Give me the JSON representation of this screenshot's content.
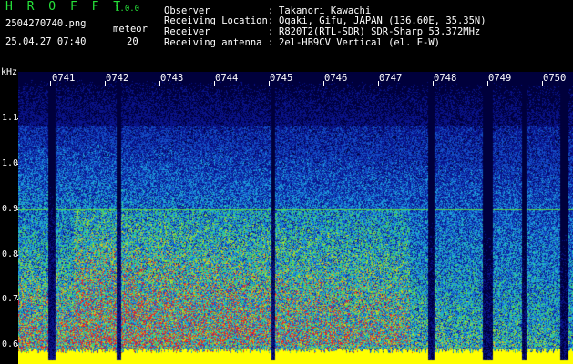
{
  "app": {
    "name": "H R O F F T",
    "version": "1.0.0"
  },
  "file": {
    "name": "2504270740.png",
    "datetime": "25.04.27 07:40"
  },
  "meteor": {
    "label": "meteor",
    "count": "20"
  },
  "info": [
    {
      "label": "Observer",
      "sep": ":",
      "value": "Takanori Kawachi"
    },
    {
      "label": "Receiving Location",
      "sep": ":",
      "value": "Ogaki, Gifu, JAPAN (136.60E, 35.35N)"
    },
    {
      "label": "Receiver",
      "sep": ":",
      "value": "R820T2(RTL-SDR) SDR-Sharp 53.372MHz"
    },
    {
      "label": "Receiving antenna",
      "sep": ":",
      "value": "2el-HB9CV Vertical (el. E-W)"
    }
  ],
  "y_axis": {
    "unit": "kHz",
    "ticks": [
      "1.1",
      "1.0",
      "0.9",
      "0.8",
      "0.7",
      "0.6"
    ]
  },
  "time_axis": {
    "ticks": [
      "0741",
      "0742",
      "0743",
      "0744",
      "0745",
      "0746",
      "0747",
      "0748",
      "0749",
      "0750"
    ]
  },
  "colors": {
    "header_text": "#ffffff",
    "title": "#26e23a",
    "background": "#000000",
    "baseline": "#ffff00"
  }
}
